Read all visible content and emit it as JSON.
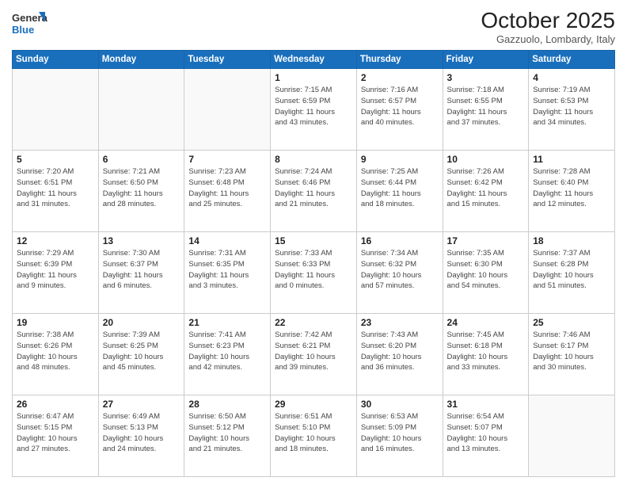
{
  "header": {
    "logo_line1": "General",
    "logo_line2": "Blue",
    "title": "October 2025",
    "subtitle": "Gazzuolo, Lombardy, Italy"
  },
  "days_of_week": [
    "Sunday",
    "Monday",
    "Tuesday",
    "Wednesday",
    "Thursday",
    "Friday",
    "Saturday"
  ],
  "weeks": [
    [
      {
        "day": "",
        "info": ""
      },
      {
        "day": "",
        "info": ""
      },
      {
        "day": "",
        "info": ""
      },
      {
        "day": "1",
        "info": "Sunrise: 7:15 AM\nSunset: 6:59 PM\nDaylight: 11 hours\nand 43 minutes."
      },
      {
        "day": "2",
        "info": "Sunrise: 7:16 AM\nSunset: 6:57 PM\nDaylight: 11 hours\nand 40 minutes."
      },
      {
        "day": "3",
        "info": "Sunrise: 7:18 AM\nSunset: 6:55 PM\nDaylight: 11 hours\nand 37 minutes."
      },
      {
        "day": "4",
        "info": "Sunrise: 7:19 AM\nSunset: 6:53 PM\nDaylight: 11 hours\nand 34 minutes."
      }
    ],
    [
      {
        "day": "5",
        "info": "Sunrise: 7:20 AM\nSunset: 6:51 PM\nDaylight: 11 hours\nand 31 minutes."
      },
      {
        "day": "6",
        "info": "Sunrise: 7:21 AM\nSunset: 6:50 PM\nDaylight: 11 hours\nand 28 minutes."
      },
      {
        "day": "7",
        "info": "Sunrise: 7:23 AM\nSunset: 6:48 PM\nDaylight: 11 hours\nand 25 minutes."
      },
      {
        "day": "8",
        "info": "Sunrise: 7:24 AM\nSunset: 6:46 PM\nDaylight: 11 hours\nand 21 minutes."
      },
      {
        "day": "9",
        "info": "Sunrise: 7:25 AM\nSunset: 6:44 PM\nDaylight: 11 hours\nand 18 minutes."
      },
      {
        "day": "10",
        "info": "Sunrise: 7:26 AM\nSunset: 6:42 PM\nDaylight: 11 hours\nand 15 minutes."
      },
      {
        "day": "11",
        "info": "Sunrise: 7:28 AM\nSunset: 6:40 PM\nDaylight: 11 hours\nand 12 minutes."
      }
    ],
    [
      {
        "day": "12",
        "info": "Sunrise: 7:29 AM\nSunset: 6:39 PM\nDaylight: 11 hours\nand 9 minutes."
      },
      {
        "day": "13",
        "info": "Sunrise: 7:30 AM\nSunset: 6:37 PM\nDaylight: 11 hours\nand 6 minutes."
      },
      {
        "day": "14",
        "info": "Sunrise: 7:31 AM\nSunset: 6:35 PM\nDaylight: 11 hours\nand 3 minutes."
      },
      {
        "day": "15",
        "info": "Sunrise: 7:33 AM\nSunset: 6:33 PM\nDaylight: 11 hours\nand 0 minutes."
      },
      {
        "day": "16",
        "info": "Sunrise: 7:34 AM\nSunset: 6:32 PM\nDaylight: 10 hours\nand 57 minutes."
      },
      {
        "day": "17",
        "info": "Sunrise: 7:35 AM\nSunset: 6:30 PM\nDaylight: 10 hours\nand 54 minutes."
      },
      {
        "day": "18",
        "info": "Sunrise: 7:37 AM\nSunset: 6:28 PM\nDaylight: 10 hours\nand 51 minutes."
      }
    ],
    [
      {
        "day": "19",
        "info": "Sunrise: 7:38 AM\nSunset: 6:26 PM\nDaylight: 10 hours\nand 48 minutes."
      },
      {
        "day": "20",
        "info": "Sunrise: 7:39 AM\nSunset: 6:25 PM\nDaylight: 10 hours\nand 45 minutes."
      },
      {
        "day": "21",
        "info": "Sunrise: 7:41 AM\nSunset: 6:23 PM\nDaylight: 10 hours\nand 42 minutes."
      },
      {
        "day": "22",
        "info": "Sunrise: 7:42 AM\nSunset: 6:21 PM\nDaylight: 10 hours\nand 39 minutes."
      },
      {
        "day": "23",
        "info": "Sunrise: 7:43 AM\nSunset: 6:20 PM\nDaylight: 10 hours\nand 36 minutes."
      },
      {
        "day": "24",
        "info": "Sunrise: 7:45 AM\nSunset: 6:18 PM\nDaylight: 10 hours\nand 33 minutes."
      },
      {
        "day": "25",
        "info": "Sunrise: 7:46 AM\nSunset: 6:17 PM\nDaylight: 10 hours\nand 30 minutes."
      }
    ],
    [
      {
        "day": "26",
        "info": "Sunrise: 6:47 AM\nSunset: 5:15 PM\nDaylight: 10 hours\nand 27 minutes."
      },
      {
        "day": "27",
        "info": "Sunrise: 6:49 AM\nSunset: 5:13 PM\nDaylight: 10 hours\nand 24 minutes."
      },
      {
        "day": "28",
        "info": "Sunrise: 6:50 AM\nSunset: 5:12 PM\nDaylight: 10 hours\nand 21 minutes."
      },
      {
        "day": "29",
        "info": "Sunrise: 6:51 AM\nSunset: 5:10 PM\nDaylight: 10 hours\nand 18 minutes."
      },
      {
        "day": "30",
        "info": "Sunrise: 6:53 AM\nSunset: 5:09 PM\nDaylight: 10 hours\nand 16 minutes."
      },
      {
        "day": "31",
        "info": "Sunrise: 6:54 AM\nSunset: 5:07 PM\nDaylight: 10 hours\nand 13 minutes."
      },
      {
        "day": "",
        "info": ""
      }
    ]
  ]
}
